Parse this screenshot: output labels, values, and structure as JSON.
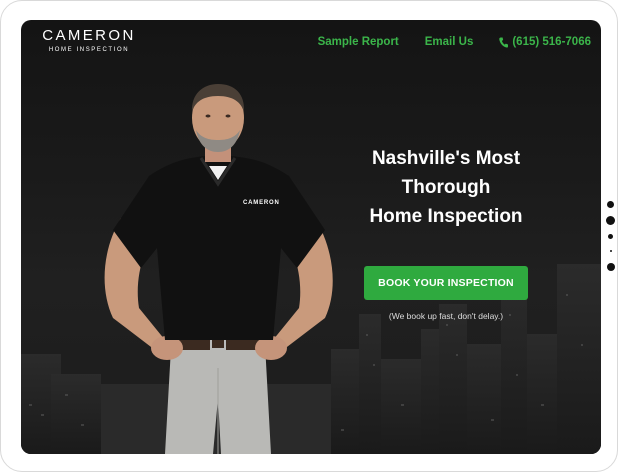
{
  "brand": {
    "name": "CAMERON",
    "tagline": "HOME INSPECTION"
  },
  "nav": [
    {
      "label": "Sample Report"
    },
    {
      "label": "Email Us"
    },
    {
      "label": "(615) 516-7066",
      "icon": "phone-icon"
    }
  ],
  "hero": {
    "headline_lines": [
      "Nashville's Most",
      "Thorough",
      "Home Inspection"
    ],
    "cta_label": "BOOK YOUR INSPECTION",
    "cta_note": "(We book up fast, don't delay.)",
    "shirt_logo": "CAMERON"
  },
  "colors": {
    "accent": "#2faa3f",
    "nav_text": "#3bb54a",
    "background": "#1a1a1a"
  }
}
